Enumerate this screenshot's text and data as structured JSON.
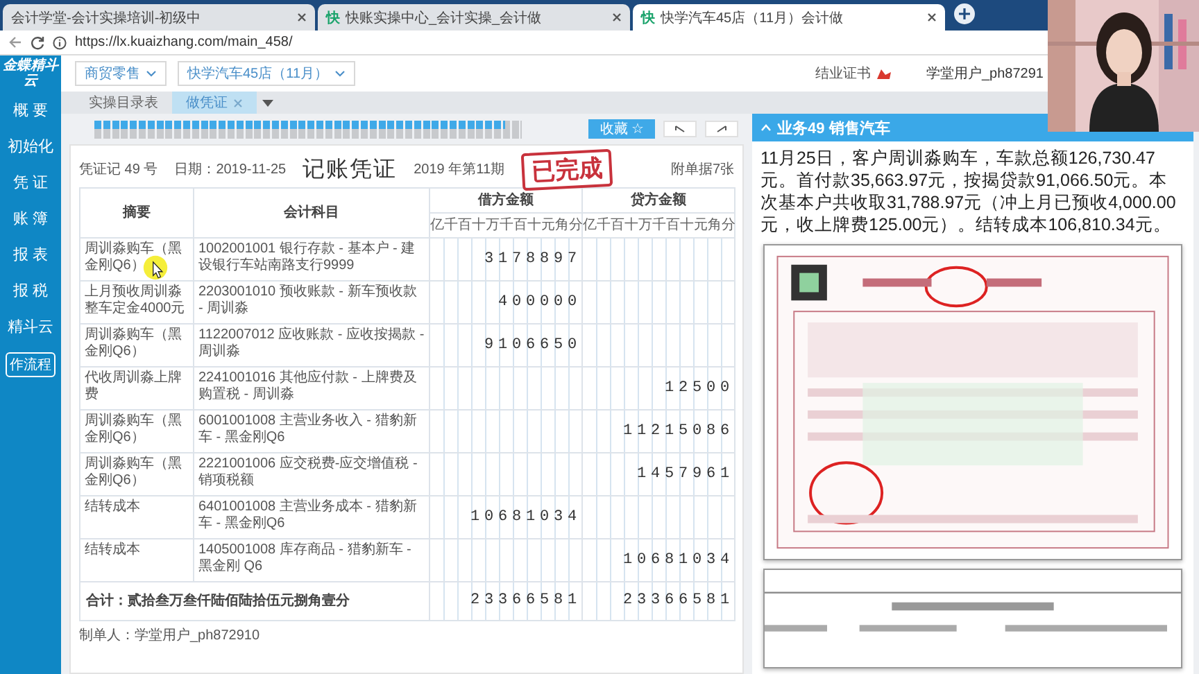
{
  "browser": {
    "tabs": [
      {
        "label": "会计学堂-会计实操培训-初级中",
        "selected": false
      },
      {
        "favicon": "快",
        "label": "快账实操中心_会计实操_会计做",
        "selected": false
      },
      {
        "favicon": "快",
        "label": "快学汽车45店（11月）会计做",
        "selected": true
      }
    ],
    "url": "https://lx.kuaizhang.com/main_458/"
  },
  "sidebar": {
    "logo": "金蝶精斗云",
    "items": [
      "概 要",
      "初始化",
      "凭 证",
      "账 簿",
      "报 表",
      "报 税",
      "精斗云"
    ],
    "flow_button": "作流程"
  },
  "header": {
    "dropdowns": [
      "商贸零售",
      "快学汽车45店（11月）"
    ],
    "certificate": "结业证书",
    "user": "学堂用户_ph87291"
  },
  "page_tabs": [
    {
      "label": "实操目录表",
      "selected": false,
      "closable": false
    },
    {
      "label": "做凭证",
      "selected": true,
      "closable": true
    }
  ],
  "task_progress": {
    "level": 0.96
  },
  "toolbar": {
    "favorite": "收藏 ☆"
  },
  "voucher": {
    "number": "凭证记 49 号",
    "date": "日期：2019-11-25",
    "title": "记账凭证",
    "period": "2019 年第11期",
    "attachments": "附单据7张",
    "stamp": "已完成",
    "columns": {
      "summary": "摘要",
      "account": "会计科目",
      "debit": "借方金额",
      "credit": "贷方金额",
      "debit_digits": "亿千百十万千百十元角分",
      "credit_digits": "亿千百十万千百十元角分"
    },
    "rows": [
      {
        "summary": "周训淼购车（黑金刚Q6）",
        "account": "1002001001 银行存款 - 基本户 - 建设银行车站南路支行9999",
        "debit": "3178897"
      },
      {
        "summary": "上月预收周训淼整车定金4000元",
        "account": "2203001010 预收账款 - 新车预收款 - 周训淼",
        "debit": "400000"
      },
      {
        "summary": "周训淼购车（黑金刚Q6）",
        "account": "1122007012 应收账款 - 应收按揭款 - 周训淼",
        "debit": "9106650"
      },
      {
        "summary": "代收周训淼上牌费",
        "account": "2241001016 其他应付款 - 上牌费及购置税 - 周训淼",
        "credit": "12500"
      },
      {
        "summary": "周训淼购车（黑金刚Q6）",
        "account": "6001001008 主营业务收入 - 猎豹新车 - 黑金刚Q6",
        "credit": "11215086"
      },
      {
        "summary": "周训淼购车（黑金刚Q6）",
        "account": "2221001006 应交税费-应交增值税 - 销项税额",
        "credit": "1457961"
      },
      {
        "summary": "结转成本",
        "account": "6401001008 主营业务成本 - 猎豹新车 - 黑金刚Q6",
        "debit": "10681034"
      },
      {
        "summary": "结转成本",
        "account": "1405001008 库存商品 - 猎豹新车 - 黑金刚 Q6",
        "credit": "10681034"
      }
    ],
    "total": {
      "text": "合计：贰拾叁万叁仟陆佰陆拾伍元捌角壹分",
      "debit": "23366581",
      "credit": "23366581"
    },
    "maker": "制单人：学堂用户_ph872910"
  },
  "task": {
    "title": "业务49 销售汽车",
    "expanded": true,
    "description": "11月25日，客户周训淼购车，车款总额126,730.47元。首付款35,663.97元，按揭贷款91,066.50元。本次基本户共收取31,788.97元（冲上月已预收4,000.00元，收上牌费125.00元）。结转成本106,810.34元。"
  }
}
